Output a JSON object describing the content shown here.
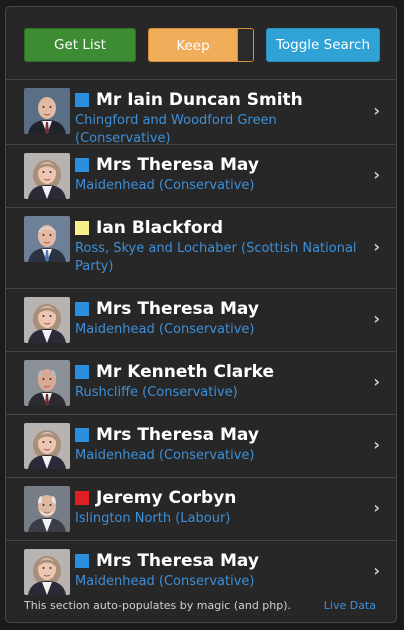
{
  "toolbar": {
    "get_list_label": "Get List",
    "keep_label": "Keep",
    "toggle_search_label": "Toggle Search"
  },
  "colors": {
    "conservative": "#2c8fde",
    "snp": "#f7ef8a",
    "labour": "#e02020"
  },
  "members": [
    {
      "name": "Mr Iain Duncan Smith",
      "constituency": "Chingford and Woodford Green (Conservative)",
      "party": "conservative",
      "avatar": "portrait-iain-duncan-smith"
    },
    {
      "name": "Mrs Theresa May",
      "constituency": "Maidenhead (Conservative)",
      "party": "conservative",
      "avatar": "portrait-theresa-may"
    },
    {
      "name": "Ian Blackford",
      "constituency": "Ross, Skye and Lochaber (Scottish National Party)",
      "party": "snp",
      "avatar": "portrait-ian-blackford"
    },
    {
      "name": "Mrs Theresa May",
      "constituency": "Maidenhead (Conservative)",
      "party": "conservative",
      "avatar": "portrait-theresa-may"
    },
    {
      "name": "Mr Kenneth Clarke",
      "constituency": "Rushcliffe (Conservative)",
      "party": "conservative",
      "avatar": "portrait-kenneth-clarke"
    },
    {
      "name": "Mrs Theresa May",
      "constituency": "Maidenhead (Conservative)",
      "party": "conservative",
      "avatar": "portrait-theresa-may"
    },
    {
      "name": "Jeremy Corbyn",
      "constituency": "Islington North (Labour)",
      "party": "labour",
      "avatar": "portrait-jeremy-corbyn"
    },
    {
      "name": "Mrs Theresa May",
      "constituency": "Maidenhead (Conservative)",
      "party": "conservative",
      "avatar": "portrait-theresa-may"
    }
  ],
  "footer": {
    "text": "This section auto-populates by magic (and php).",
    "link": "Live Data"
  }
}
